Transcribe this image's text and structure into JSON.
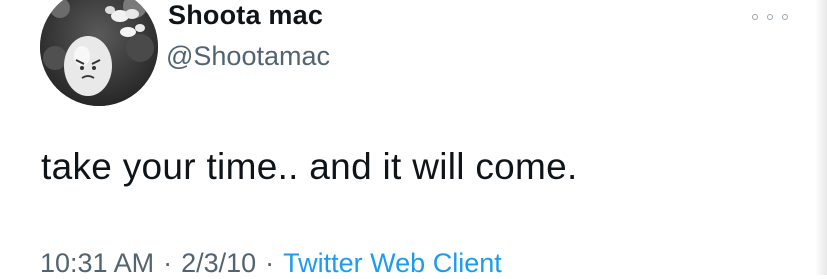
{
  "tweet": {
    "author": {
      "display_name": "Shoota mac",
      "handle": "@Shootamac",
      "avatar_icon": "egg-face-avatar"
    },
    "more_icon": "more-dots-icon",
    "text": "take your time.. and it will come.",
    "meta": {
      "time": "10:31 AM",
      "separator": "·",
      "date": "2/3/10",
      "source": "Twitter Web Client"
    }
  },
  "colors": {
    "text_primary": "#0f1419",
    "text_secondary": "#536471",
    "link": "#1d9bf0"
  }
}
